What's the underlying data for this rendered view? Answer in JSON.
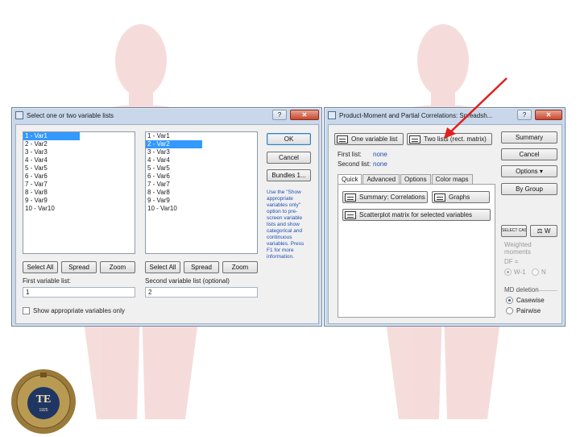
{
  "left_dialog": {
    "title": "Select one or two variable lists",
    "help_btn": "?",
    "close_btn": "✕",
    "first_list_items": [
      "1 - Var1",
      "2 - Var2",
      "3 - Var3",
      "4 - Var4",
      "5 - Var5",
      "6 - Var6",
      "7 - Var7",
      "8 - Var8",
      "9 - Var9",
      "10 - Var10"
    ],
    "first_list_selected": 0,
    "second_list_items": [
      "1 - Var1",
      "2 - Var2",
      "3 - Var3",
      "4 - Var4",
      "5 - Var5",
      "6 - Var6",
      "7 - Var7",
      "8 - Var8",
      "9 - Var9",
      "10 - Var10"
    ],
    "second_list_selected": 1,
    "ok_label": "OK",
    "cancel_label": "Cancel",
    "bundles_label": "Bundles 1...",
    "hint_text": "Use the \"Show appropriate variables only\" option to pre-screen variable lists and show categorical and continuous variables. Press F1 for more information.",
    "select_all_label": "Select All",
    "spread_label": "Spread",
    "zoom_label": "Zoom",
    "first_var_list_label": "First variable list:",
    "first_var_list_value": "1",
    "second_var_list_label": "Second variable list (optional)",
    "second_var_list_value": "2",
    "show_appropriate_label": "Show appropriate variables only"
  },
  "right_dialog": {
    "title": "Product-Moment and Partial Correlations: Spreadsh...",
    "help_btn": "?",
    "close_btn": "✕",
    "one_list_label": "One variable list",
    "two_lists_label": "Two lists (rect. matrix)",
    "first_list_label": "First list:",
    "first_list_value": "none",
    "second_list_label": "Second list:",
    "second_list_value": "none",
    "tabs": [
      "Quick",
      "Advanced",
      "Options",
      "Color maps"
    ],
    "summary_corr_label": "Summary: Correlations",
    "graphs_label": "Graphs",
    "scatter_label": "Scatterplot matrix for selected variables",
    "summary_btn": "Summary",
    "cancel_btn": "Cancel",
    "options_btn": "Options",
    "bygroup_btn": "By Group",
    "save_btn_text": "SELECT CASES",
    "w_label": "W",
    "weighted_label": "Weighted moments",
    "df_label": "DF =",
    "df_w1": "W-1",
    "df_n": "N",
    "md_label": "MD deletion",
    "casewise_label": "Casewise",
    "pairwise_label": "Pairwise"
  },
  "logo": {
    "initials": "TE",
    "year": "1925"
  },
  "colors": {
    "arrow": "#e02020",
    "selection": "#3399ff",
    "hint_text": "#1f4fb3",
    "window_frame": "#c8d8ea"
  }
}
